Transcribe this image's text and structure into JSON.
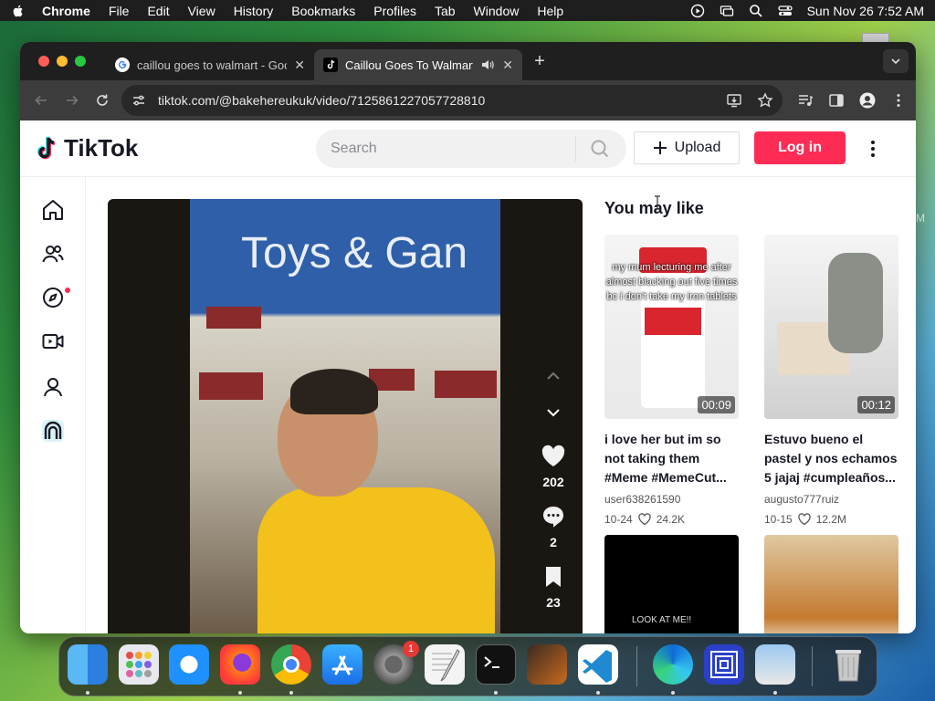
{
  "menubar": {
    "items": [
      "Chrome",
      "File",
      "Edit",
      "View",
      "History",
      "Bookmarks",
      "Profiles",
      "Tab",
      "Window",
      "Help"
    ],
    "datetime": "Sun Nov 26  7:52 AM"
  },
  "desktop": {
    "side_text": "M"
  },
  "browser": {
    "tabs": [
      {
        "title": "caillou goes to walmart - Goo",
        "active": false
      },
      {
        "title": "Caillou Goes To Walmart L",
        "active": true
      }
    ],
    "url": "tiktok.com/@bakehereukuk/video/7125861227057728810"
  },
  "tiktok": {
    "logo": "TikTok",
    "search": {
      "placeholder": "Search"
    },
    "upload_label": "Upload",
    "login_label": "Log in",
    "video": {
      "banner_text": "Toys & Gan",
      "likes": "202",
      "comments": "2",
      "saves": "23"
    },
    "you_may_like": {
      "title": "You may like",
      "cards": [
        {
          "overlay": "my mum lecturing me after almost blacking out five times bc i don't take my iron tablets",
          "duration": "00:09",
          "caption": "i love her but im so not taking them #Meme #MemeCut...",
          "user": "user638261590",
          "date": "10-24",
          "likes": "24.2K"
        },
        {
          "overlay": "",
          "duration": "00:12",
          "caption": "Estuvo bueno el pastel y nos echamos 5 jajaj #cumpleaños...",
          "user": "augusto777ruiz",
          "date": "10-15",
          "likes": "12.2M"
        },
        {
          "overlay": "LOOK AT ME!!"
        },
        {
          "overlay": ""
        }
      ]
    }
  },
  "dock": {
    "settings_badge": "1"
  },
  "colors": {
    "accent": "#fe2c55",
    "tab_bar": "#1f1f1f",
    "toolbar": "#3c3c3c"
  }
}
